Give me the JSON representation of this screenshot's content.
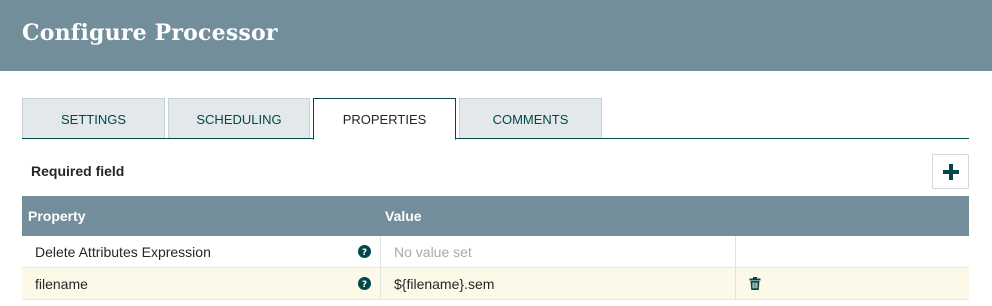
{
  "dialog": {
    "title": "Configure Processor"
  },
  "tabs": [
    {
      "label": "SETTINGS",
      "active": false
    },
    {
      "label": "SCHEDULING",
      "active": false
    },
    {
      "label": "PROPERTIES",
      "active": true
    },
    {
      "label": "COMMENTS",
      "active": false
    }
  ],
  "properties": {
    "required_label": "Required field",
    "add_icon": "plus-icon",
    "columns": {
      "property": "Property",
      "value": "Value"
    },
    "rows": [
      {
        "name": "Delete Attributes Expression",
        "value": "No value set",
        "value_is_placeholder": true,
        "help_icon": "question-circle-icon",
        "deletable": false
      },
      {
        "name": "filename",
        "value": "${filename}.sem",
        "value_is_placeholder": false,
        "help_icon": "question-circle-icon",
        "deletable": true,
        "delete_icon": "trash-icon"
      }
    ]
  },
  "colors": {
    "header": "#728e9b",
    "accent": "#004849",
    "tab_inactive_bg": "#e3e8eb",
    "highlight_row": "#fdf9e9"
  }
}
